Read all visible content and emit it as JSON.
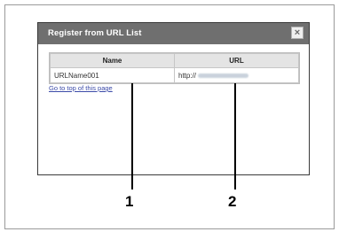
{
  "dialog": {
    "title": "Register from URL List",
    "close_glyph": "×",
    "table": {
      "headers": [
        "Name",
        "URL"
      ],
      "rows": [
        {
          "name": "URLName001",
          "url": "http://"
        }
      ]
    },
    "link_text": "Go to top of this page"
  },
  "callouts": [
    "1",
    "2"
  ]
}
